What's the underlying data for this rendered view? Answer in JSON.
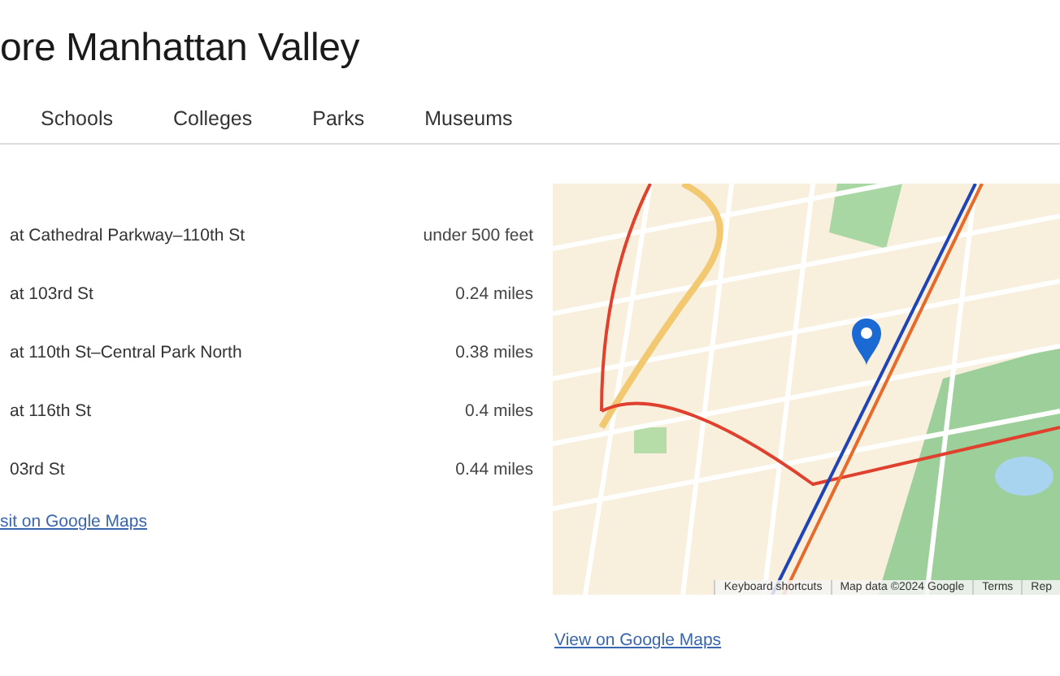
{
  "title": "ore Manhattan Valley",
  "tabs": [
    {
      "label": "Schools",
      "selected": false
    },
    {
      "label": "Colleges",
      "selected": false
    },
    {
      "label": "Parks",
      "selected": false
    },
    {
      "label": "Museums",
      "selected": false
    }
  ],
  "stations": [
    {
      "name": "at Cathedral Parkway–110th St",
      "distance": "under 500 feet"
    },
    {
      "name": "at 103rd St",
      "distance": "0.24 miles"
    },
    {
      "name": "at 110th St–Central Park North",
      "distance": "0.38 miles"
    },
    {
      "name": "at 116th St",
      "distance": "0.4 miles"
    },
    {
      "name": "03rd St",
      "distance": "0.44 miles"
    }
  ],
  "list_link": "sit on Google Maps",
  "map": {
    "kind": "picture",
    "attribution": [
      "Keyboard shortcuts",
      "Map data ©2024 Google",
      "Terms",
      "Rep"
    ]
  },
  "map_link": "View on Google Maps"
}
